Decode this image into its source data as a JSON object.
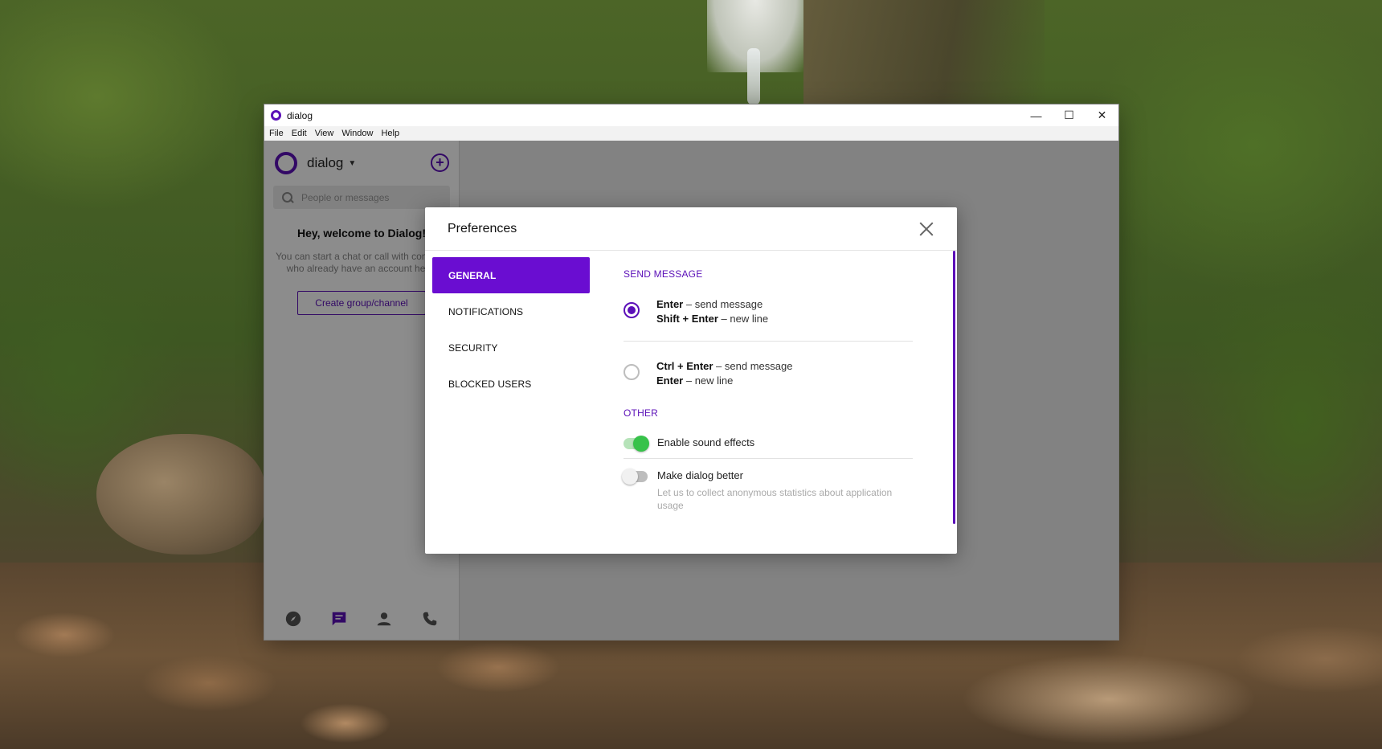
{
  "window": {
    "title": "dialog",
    "controls": {
      "minimize": "—",
      "maximize": "☐",
      "close": "✕"
    }
  },
  "menubar": [
    "File",
    "Edit",
    "View",
    "Window",
    "Help"
  ],
  "sidebar": {
    "app_name": "dialog",
    "search_placeholder": "People or messages",
    "welcome_title": "Hey, welcome to Dialog!",
    "welcome_text": "You can start a chat or call with contacts who already have an account here.",
    "create_button": "Create group/channel",
    "bottom_nav": [
      {
        "icon": "compass-icon",
        "active": false
      },
      {
        "icon": "chat-icon",
        "active": true
      },
      {
        "icon": "contacts-icon",
        "active": false
      },
      {
        "icon": "phone-icon",
        "active": false
      }
    ]
  },
  "preferences": {
    "title": "Preferences",
    "tabs": [
      "GENERAL",
      "NOTIFICATIONS",
      "SECURITY",
      "BLOCKED USERS"
    ],
    "active_tab": "GENERAL",
    "send_message": {
      "section_title": "SEND MESSAGE",
      "options": [
        {
          "line1_key": "Enter",
          "line1_rest": " – send message",
          "line2_key": "Shift + Enter",
          "line2_rest": " – new line",
          "selected": true
        },
        {
          "line1_key": "Ctrl + Enter",
          "line1_rest": " – send message",
          "line2_key": "Enter",
          "line2_rest": " – new line",
          "selected": false
        }
      ]
    },
    "other": {
      "section_title": "OTHER",
      "toggles": [
        {
          "label": "Enable sound effects",
          "on": true
        },
        {
          "label": "Make dialog better",
          "on": false,
          "description": "Let us to collect anonymous statistics about application usage"
        }
      ]
    }
  },
  "colors": {
    "accent": "#5b0fb8",
    "tab_active": "#6a0dd1",
    "toggle_on": "#37c24a"
  }
}
